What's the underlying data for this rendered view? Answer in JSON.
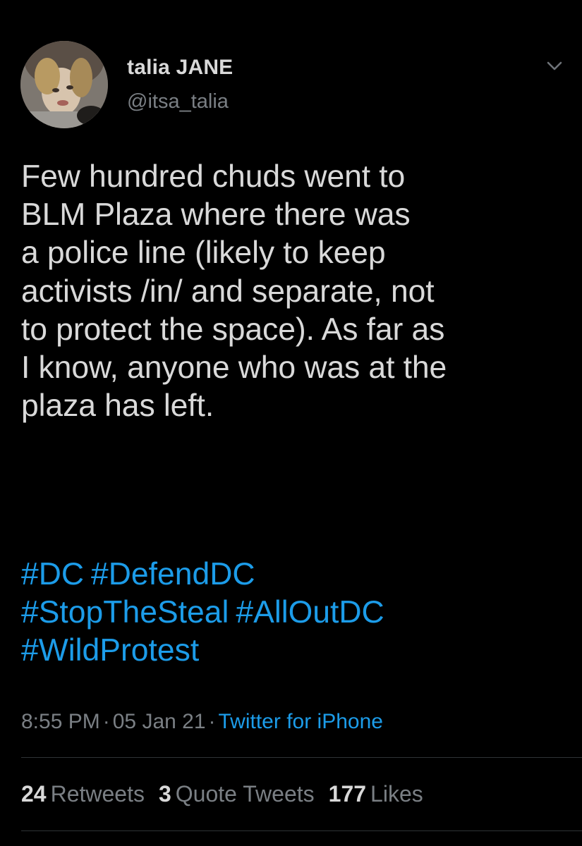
{
  "author": {
    "display_name": "talia JANE",
    "handle": "@itsa_talia"
  },
  "tweet": {
    "text": "Few hundred chuds went to\nBLM Plaza where there was\na police line (likely to keep\nactivists /in/ and separate, not\nto protect the space). As far as\nI know, anyone who was at the\nplaza has left.",
    "hashtag_lines": [
      [
        "#DC",
        "#DefendDC"
      ],
      [
        "#StopTheSteal",
        "#AllOutDC"
      ],
      [
        "#WildProtest"
      ]
    ]
  },
  "meta": {
    "time": "8:55 PM",
    "separator": "·",
    "date": "05 Jan 21",
    "source": "Twitter for iPhone"
  },
  "stats": {
    "retweets_count": "24",
    "retweets_label": "Retweets",
    "quotes_count": "3",
    "quotes_label": "Quote Tweets",
    "likes_count": "177",
    "likes_label": "Likes"
  },
  "icons": {
    "more": "chevron-down-icon"
  },
  "colors": {
    "background": "#000000",
    "text": "#d9d9d9",
    "muted": "#7a7f84",
    "link": "#1c9ce9",
    "divider": "#2f3336"
  }
}
